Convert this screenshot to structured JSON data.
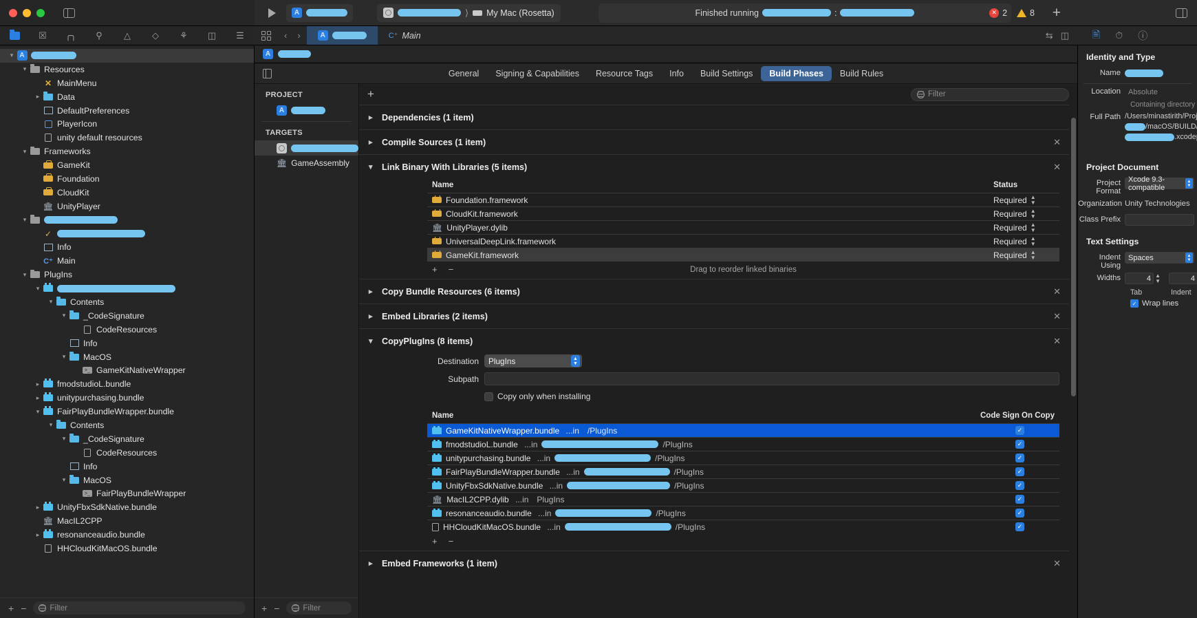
{
  "toolbar": {
    "scheme_redacted": true,
    "destination_label": "My Mac (Rosetta)",
    "status_prefix": "Finished running",
    "error_count": "2",
    "warning_count": "8",
    "add_label": "+"
  },
  "navigator": {
    "tabs": [
      "folder-icon",
      "x-box-icon",
      "hierarchy-icon",
      "search-icon",
      "warning-icon",
      "diamond-icon",
      "debug-icon",
      "tag-icon",
      "report-icon"
    ],
    "filter_placeholder": "Filter",
    "tree": [
      {
        "indent": 0,
        "twisty": "v",
        "icon": "app-icon",
        "label": "",
        "redacted": true,
        "redactw": 66,
        "selected": true
      },
      {
        "indent": 1,
        "twisty": "v",
        "icon": "folder-grey",
        "label": "Resources"
      },
      {
        "indent": 2,
        "twisty": "",
        "icon": "x-yellow",
        "label": "MainMenu"
      },
      {
        "indent": 2,
        "twisty": ">",
        "icon": "folder-blue",
        "label": "Data"
      },
      {
        "indent": 2,
        "twisty": "",
        "icon": "plist",
        "label": "DefaultPreferences"
      },
      {
        "indent": 2,
        "twisty": "",
        "icon": "asset",
        "label": "PlayerIcon"
      },
      {
        "indent": 2,
        "twisty": "",
        "icon": "file",
        "label": "unity default resources"
      },
      {
        "indent": 1,
        "twisty": "v",
        "icon": "folder-grey",
        "label": "Frameworks"
      },
      {
        "indent": 2,
        "twisty": "",
        "icon": "framework",
        "label": "GameKit"
      },
      {
        "indent": 2,
        "twisty": "",
        "icon": "framework",
        "label": "Foundation"
      },
      {
        "indent": 2,
        "twisty": "",
        "icon": "framework",
        "label": "CloudKit"
      },
      {
        "indent": 2,
        "twisty": "",
        "icon": "dylib",
        "label": "UnityPlayer"
      },
      {
        "indent": 1,
        "twisty": "v",
        "icon": "folder-grey",
        "label": "",
        "redacted": true,
        "redactw": 107
      },
      {
        "indent": 2,
        "twisty": "",
        "icon": "cert",
        "label": "",
        "redacted": true,
        "redactw": 128
      },
      {
        "indent": 2,
        "twisty": "",
        "icon": "plist",
        "label": "Info"
      },
      {
        "indent": 2,
        "twisty": "",
        "icon": "cpp",
        "label": "Main"
      },
      {
        "indent": 1,
        "twisty": "v",
        "icon": "folder-grey",
        "label": "PlugIns"
      },
      {
        "indent": 2,
        "twisty": "v",
        "icon": "bundle",
        "label": "",
        "redacted": true,
        "redactw": 172
      },
      {
        "indent": 3,
        "twisty": "v",
        "icon": "folder-blue",
        "label": "Contents"
      },
      {
        "indent": 4,
        "twisty": "v",
        "icon": "folder-blue",
        "label": "_CodeSignature"
      },
      {
        "indent": 5,
        "twisty": "",
        "icon": "file",
        "label": "CodeResources"
      },
      {
        "indent": 4,
        "twisty": "",
        "icon": "plist",
        "label": "Info"
      },
      {
        "indent": 4,
        "twisty": "v",
        "icon": "folder-blue",
        "label": "MacOS"
      },
      {
        "indent": 5,
        "twisty": "",
        "icon": "exec",
        "label": "GameKitNativeWrapper"
      },
      {
        "indent": 2,
        "twisty": ">",
        "icon": "bundle",
        "label": "fmodstudioL.bundle"
      },
      {
        "indent": 2,
        "twisty": ">",
        "icon": "bundle",
        "label": "unitypurchasing.bundle"
      },
      {
        "indent": 2,
        "twisty": "v",
        "icon": "bundle",
        "label": "FairPlayBundleWrapper.bundle"
      },
      {
        "indent": 3,
        "twisty": "v",
        "icon": "folder-blue",
        "label": "Contents"
      },
      {
        "indent": 4,
        "twisty": "v",
        "icon": "folder-blue",
        "label": "_CodeSignature"
      },
      {
        "indent": 5,
        "twisty": "",
        "icon": "file",
        "label": "CodeResources"
      },
      {
        "indent": 4,
        "twisty": "",
        "icon": "plist",
        "label": "Info"
      },
      {
        "indent": 4,
        "twisty": "v",
        "icon": "folder-blue",
        "label": "MacOS"
      },
      {
        "indent": 5,
        "twisty": "",
        "icon": "exec",
        "label": "FairPlayBundleWrapper"
      },
      {
        "indent": 2,
        "twisty": ">",
        "icon": "bundle",
        "label": "UnityFbxSdkNative.bundle"
      },
      {
        "indent": 2,
        "twisty": "",
        "icon": "dylib",
        "label": "MacIL2CPP"
      },
      {
        "indent": 2,
        "twisty": ">",
        "icon": "bundle",
        "label": "resonanceaudio.bundle"
      },
      {
        "indent": 2,
        "twisty": "",
        "icon": "file",
        "label": "HHCloudKitMacOS.bundle"
      }
    ]
  },
  "editor": {
    "tabs": [
      {
        "label": "",
        "redacted": true,
        "selected": true,
        "icon": "app-icon"
      },
      {
        "label": "Main",
        "selected": false,
        "icon": "cpp-icon"
      }
    ],
    "project_tabs": [
      "General",
      "Signing & Capabilities",
      "Resource Tags",
      "Info",
      "Build Settings",
      "Build Phases",
      "Build Rules"
    ],
    "selected_project_tab": "Build Phases",
    "project_section_label": "PROJECT",
    "targets_section_label": "TARGETS",
    "project_item_redacted": true,
    "targets": [
      {
        "label": "",
        "redacted": true,
        "selected": true,
        "icon": "target-icon"
      },
      {
        "label": "GameAssembly",
        "selected": false,
        "icon": "dylib-icon"
      }
    ],
    "targets_filter_placeholder": "Filter",
    "phases_filter_placeholder": "Filter",
    "phases": [
      {
        "title": "Dependencies (1 item)",
        "expanded": false
      },
      {
        "title": "Compile Sources (1 item)",
        "expanded": false
      },
      {
        "title": "Link Binary With Libraries (5 items)",
        "expanded": true,
        "columns": [
          "Name",
          "Status"
        ],
        "rows": [
          {
            "name": "Foundation.framework",
            "icon": "framework",
            "status": "Required",
            "selected": false
          },
          {
            "name": "CloudKit.framework",
            "icon": "framework",
            "status": "Required",
            "selected": false
          },
          {
            "name": "UnityPlayer.dylib",
            "icon": "dylib",
            "status": "Required",
            "selected": false
          },
          {
            "name": "UniversalDeepLink.framework",
            "icon": "framework",
            "status": "Required",
            "selected": false
          },
          {
            "name": "GameKit.framework",
            "icon": "framework",
            "status": "Required",
            "selected": true
          }
        ],
        "footer_hint": "Drag to reorder linked binaries"
      },
      {
        "title": "Copy Bundle Resources (6 items)",
        "expanded": false
      },
      {
        "title": "Embed Libraries (2 items)",
        "expanded": false
      },
      {
        "title": "CopyPlugIns (8 items)",
        "expanded": true,
        "destination_label": "Destination",
        "destination_value": "PlugIns",
        "subpath_label": "Subpath",
        "subpath_value": "",
        "copy_only_label": "Copy only when installing",
        "copy_only_checked": false,
        "columns": [
          "Name",
          "Code Sign On Copy"
        ],
        "rows": [
          {
            "name": "GameKitNativeWrapper.bundle",
            "path_prefix": "...in",
            "path_suffix": "/PlugIns",
            "icon": "bundle",
            "checked": true,
            "selected": true
          },
          {
            "name": "fmodstudioL.bundle",
            "path_prefix": "...in",
            "path_suffix": "/PlugIns",
            "icon": "bundle",
            "checked": true,
            "selected": false
          },
          {
            "name": "unitypurchasing.bundle",
            "path_prefix": "...in",
            "path_suffix": "/PlugIns",
            "icon": "bundle",
            "checked": true,
            "selected": false
          },
          {
            "name": "FairPlayBundleWrapper.bundle",
            "path_prefix": "...in",
            "path_suffix": "/PlugIns",
            "icon": "bundle",
            "checked": true,
            "selected": false
          },
          {
            "name": "UnityFbxSdkNative.bundle",
            "path_prefix": "...in",
            "path_suffix": "/PlugIns",
            "icon": "bundle",
            "checked": true,
            "selected": false
          },
          {
            "name": "MacIL2CPP.dylib",
            "path_prefix": "...in",
            "path_suffix": "PlugIns",
            "icon": "dylib",
            "checked": true,
            "selected": false
          },
          {
            "name": "resonanceaudio.bundle",
            "path_prefix": "...in",
            "path_suffix": "/PlugIns",
            "icon": "bundle",
            "checked": true,
            "selected": false
          },
          {
            "name": "HHCloudKitMacOS.bundle",
            "path_prefix": "...in",
            "path_suffix": "/PlugIns",
            "icon": "file",
            "checked": true,
            "selected": false
          }
        ]
      },
      {
        "title": "Embed Frameworks (1 item)",
        "expanded": false
      }
    ]
  },
  "inspector": {
    "identity_header": "Identity and Type",
    "name_label": "Name",
    "name_value_redacted": true,
    "location_label": "Location",
    "location_value": "Absolute",
    "containing_dir_label": "Containing directory",
    "full_path_label": "Full Path",
    "full_path_line1": "/Users/minastirith/Projects/",
    "full_path_line2_suffix": "/macOS/BUILD/",
    "full_path_line3_suffix": ".xcodeproj",
    "project_doc_header": "Project Document",
    "project_format_label": "Project Format",
    "project_format_value": "Xcode 9.3-compatible",
    "organization_label": "Organization",
    "organization_value": "Unity Technologies",
    "class_prefix_label": "Class Prefix",
    "class_prefix_value": "",
    "text_settings_header": "Text Settings",
    "indent_using_label": "Indent Using",
    "indent_using_value": "Spaces",
    "widths_label": "Widths",
    "tab_width": "4",
    "indent_width": "4",
    "tab_sublabel": "Tab",
    "indent_sublabel": "Indent",
    "wrap_lines_label": "Wrap lines",
    "wrap_lines_checked": true
  },
  "colors": {
    "accent": "#2b7fe0",
    "selection": "#0a5ad6",
    "redact": "#76c5f0",
    "error": "#e8453c",
    "warning": "#f0b429"
  }
}
